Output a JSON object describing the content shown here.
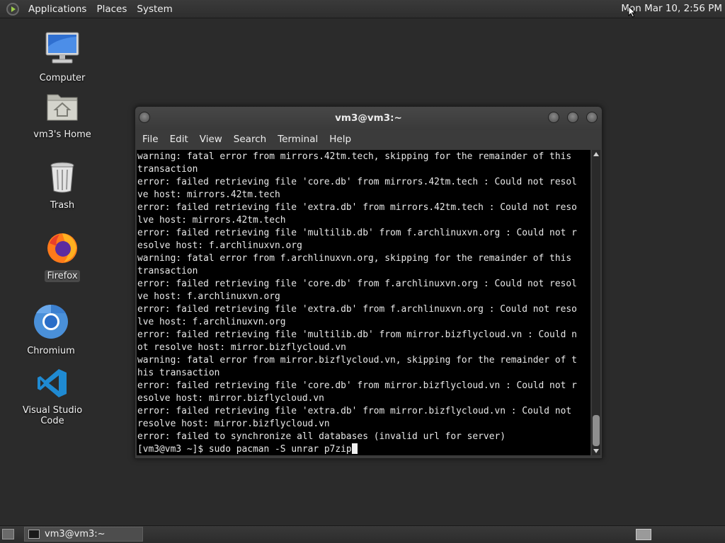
{
  "top_panel": {
    "menus": [
      "Applications",
      "Places",
      "System"
    ],
    "clock": "Mon Mar 10,  2:56 PM"
  },
  "desktop": {
    "icons": [
      {
        "label": "Computer",
        "icon": "computer-icon"
      },
      {
        "label": "vm3's Home",
        "icon": "home-folder-icon"
      },
      {
        "label": "Trash",
        "icon": "trash-icon"
      },
      {
        "label": "Firefox",
        "icon": "firefox-icon"
      },
      {
        "label": "Chromium",
        "icon": "chromium-icon"
      },
      {
        "label": "Visual Studio Code",
        "icon": "vscode-icon"
      }
    ]
  },
  "terminal": {
    "title": "vm3@vm3:~",
    "menu": [
      "File",
      "Edit",
      "View",
      "Search",
      "Terminal",
      "Help"
    ],
    "lines": [
      "warning: fatal error from mirrors.42tm.tech, skipping for the remainder of this",
      "transaction",
      "error: failed retrieving file 'core.db' from mirrors.42tm.tech : Could not resol",
      "ve host: mirrors.42tm.tech",
      "error: failed retrieving file 'extra.db' from mirrors.42tm.tech : Could not reso",
      "lve host: mirrors.42tm.tech",
      "error: failed retrieving file 'multilib.db' from f.archlinuxvn.org : Could not r",
      "esolve host: f.archlinuxvn.org",
      "warning: fatal error from f.archlinuxvn.org, skipping for the remainder of this",
      "transaction",
      "error: failed retrieving file 'core.db' from f.archlinuxvn.org : Could not resol",
      "ve host: f.archlinuxvn.org",
      "error: failed retrieving file 'extra.db' from f.archlinuxvn.org : Could not reso",
      "lve host: f.archlinuxvn.org",
      "error: failed retrieving file 'multilib.db' from mirror.bizflycloud.vn : Could n",
      "ot resolve host: mirror.bizflycloud.vn",
      "warning: fatal error from mirror.bizflycloud.vn, skipping for the remainder of t",
      "his transaction",
      "error: failed retrieving file 'core.db' from mirror.bizflycloud.vn : Could not r",
      "esolve host: mirror.bizflycloud.vn",
      "error: failed retrieving file 'extra.db' from mirror.bizflycloud.vn : Could not",
      "resolve host: mirror.bizflycloud.vn",
      "error: failed to synchronize all databases (invalid url for server)"
    ],
    "prompt": "[vm3@vm3 ~]$ ",
    "command": "sudo pacman -S unrar p7zip"
  },
  "taskbar": {
    "items": [
      {
        "label": "vm3@vm3:~"
      }
    ]
  }
}
